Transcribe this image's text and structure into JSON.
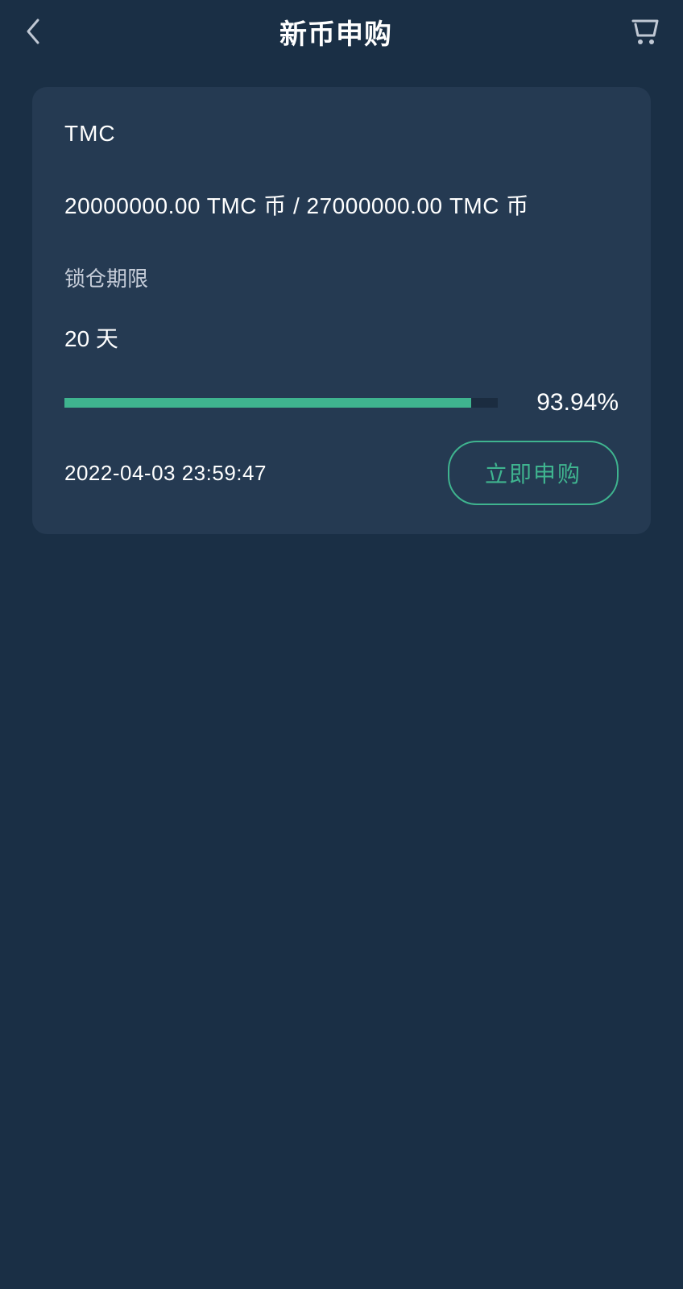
{
  "header": {
    "title": "新币申购"
  },
  "card": {
    "coin_name": "TMC",
    "amount_text": "20000000.00 TMC 币 / 27000000.00 TMC 币",
    "lock_label": "锁仓期限",
    "lock_value": "20 天",
    "progress_percent": "93.94%",
    "progress_fill_width": "93.94%",
    "timestamp": "2022-04-03 23:59:47",
    "apply_label": "立即申购"
  },
  "colors": {
    "bg": "#1a2f45",
    "card_bg": "#253a52",
    "accent": "#3fb48f"
  }
}
